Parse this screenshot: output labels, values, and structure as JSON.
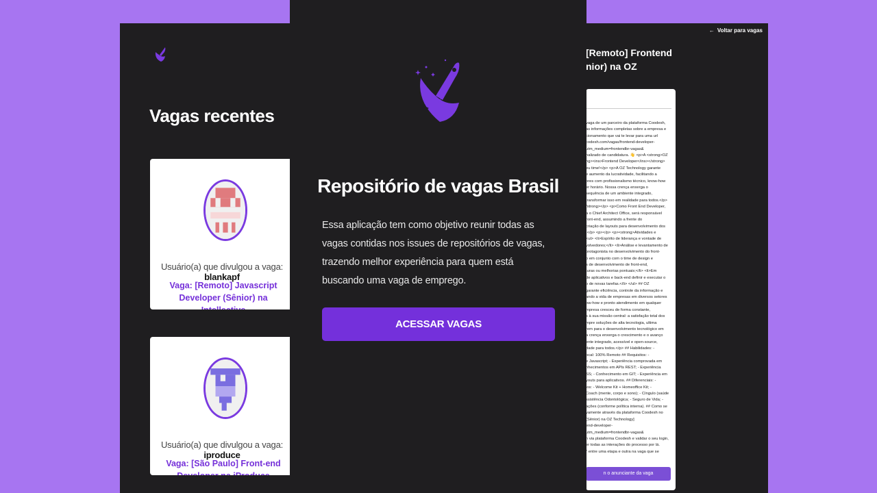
{
  "app": {
    "title": "Repositório de vagas Brasil"
  },
  "home": {
    "section_title": "Vagas recentes",
    "user_prefix": "Usuário(a) que divulgou a vaga: ",
    "cards": [
      {
        "username": "blankapf",
        "job": "Vaga: [Remoto] Javascript Developer (Sênior) na Intellective",
        "avatar_color": "#e07b7e"
      },
      {
        "username": "iproduce",
        "job": "Vaga: [São Paulo] Front-end Developer na iProduce",
        "avatar_color": "#7a6ee0"
      }
    ]
  },
  "detail": {
    "back_label": "Voltar para vagas",
    "title": "[Remoto] Frontend\nnior) na OZ",
    "body": "vaga de um parceiro da plataforma Coodesh,\nas informações completas sobre a empresa e\ncionamento que vai te levar para uma url\ncodesh.com/vagas/frontend-developer-\nutm_medium=frontendbr-vagas&\nnalizado de candidatura. 👋 <p>A <strong>OZ\nng><ins>Frontend Developer</ins></strong>\neu time!</p> <p>A OZ Technology garante\ne aumento da lucratividade, facilitando a\nores com profissionalismo técnico, know-how\ner horário. Nossa crença enxerga o\nsequência de um ambiente integrado,\ntransformar isso em realidade para todos.</p>\n/strong></p> <p>Como Front End Developer,\na o Chief Architect Office, será responsável\nront-end, assumindo a frente do\ncriação de layouts para desenvolvimento dos\n.</p> <p></p> <p><strong>Atividades e\n<ul> <li>Espírito de liderança e vontade de\nvolvedores;</li> <li>Análise e levantamento de\nprotagonista no desenvolvimento do front-\no em conjunto com o time de design e\ns de desenvolvimento de front-end,\nturas ou melhorias pontuais;</li> <li>Em\nde aplicativos e back-end definir e executar o\no de novas tarefas.</li> </ul>  ## OZ\ngarante eficiência, controle da informação e\nando a vida de empresas em diversos setores\now-how e pronto atendimento em qualquer\nmpresa cresceu de forma constante,\ns à sua missão central: a satisfação total dos\nmpre soluções de alta tecnologia, ultima\nrem para o desenvolvimento tecnológico em\na crença enxerga o crescimento e o avanço\nente integrado, acessível e open-source,\ndade para todos.</p>  ## Habilidades:  -\nocal:  100% Remoto ## Requisitos:  -\ne Javascript;  - Experiência comprovada em\nnhecimentos em APIs REST;  - Experiência\nSS;  - Conhecimento em GIT;  - Experiência em\nyouts para aplicativos. ## Diferenciais:  -\nios:  - Welcome Kit + Homeoffice Kit;  -\nCoach (mente, corpo e sono);  - Cíngulo (saúde\nssistência Odontológica;  - Seguro de Vida;  -\nações (conforme política interna). ## Como se\nvamente através da plataforma Coodesh no\n(Sênior) na OZ Technology]\nend-developer-\nutm_medium=frontendbr-vagas&\nn via plataforma Coodesh e validar o seu login,\ner todas as interações do processo por lá.\n\" entre uma etapa e outra na vaga que se\nessoa **Recruiter** responsável pelo processo\n## Labels #### Alocação Remoto ####",
    "contact_label": "n o anunciante da vaga"
  },
  "modal": {
    "title": "Repositório de vagas Brasil",
    "description": "Essa aplicação tem como objetivo reunir todas as vagas contidas nos issues de repositórios de vagas, trazendo melhor experiência para quem está buscando uma vaga de emprego.",
    "button_label": "ACESSAR VAGAS"
  },
  "colors": {
    "background": "#a775f1",
    "panel": "#1f1e20",
    "accent": "#7430db",
    "link": "#7530d9"
  }
}
